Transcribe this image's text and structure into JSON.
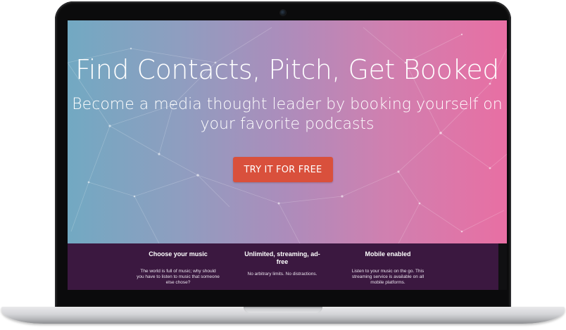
{
  "hero": {
    "title": "Find Contacts, Pitch, Get Booked",
    "subtitle": "Become a media thought leader by booking yourself on your favorite podcasts",
    "cta_label": "TRY IT FOR FREE"
  },
  "features": [
    {
      "title": "Choose your music",
      "description": "The world is full of music; why should you have to listen to music that someone else chose?"
    },
    {
      "title": "Unlimited, streaming, ad-free",
      "description": "No arbitrary limits. No distractions."
    },
    {
      "title": "Mobile enabled",
      "description": "Listen to your music on the go. This streaming service is available on all mobile platforms."
    }
  ],
  "colors": {
    "hero_gradient_start": "#72a9c2",
    "hero_gradient_end": "#e86fa3",
    "cta_background": "#d9503c",
    "features_background": "#3b1840",
    "text": "#ffffff"
  }
}
